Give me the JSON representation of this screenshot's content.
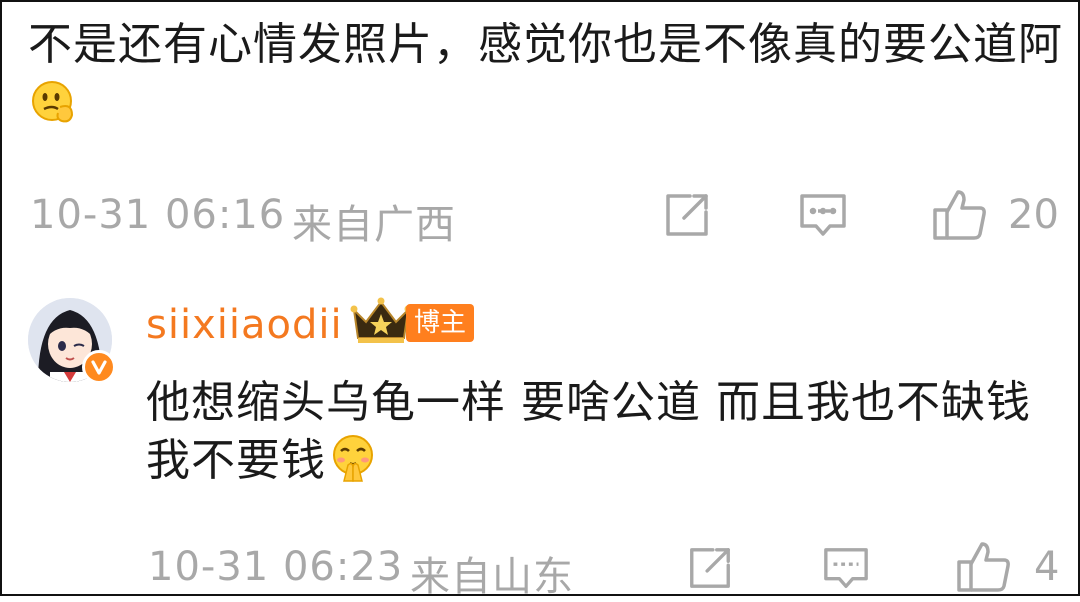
{
  "comment1": {
    "text": "不是还有心情发照片，感觉你也是不像真的要公道阿",
    "emoji": "thinking-face-emoji",
    "time": "10-31 06:16",
    "location": "来自广西",
    "likes": "20"
  },
  "comment2": {
    "username": "siixiiaodii",
    "badge": "博主",
    "text": "他想缩头乌龟一样 要啥公道 而且我也不缺钱 我不要钱",
    "emoji": "pleading-hands-emoji",
    "time": "10-31 06:23",
    "location": "来自山东",
    "likes": "4"
  },
  "icons": {
    "share": "share-icon",
    "comment": "comment-icon",
    "like": "thumbs-up-icon",
    "verified": "verified-v-icon",
    "crown": "crown-icon"
  },
  "colors": {
    "username": "#f47920",
    "badge_bg": "#ff7f1e",
    "meta_gray": "#a8a8a8",
    "text": "#1a1a1a"
  }
}
